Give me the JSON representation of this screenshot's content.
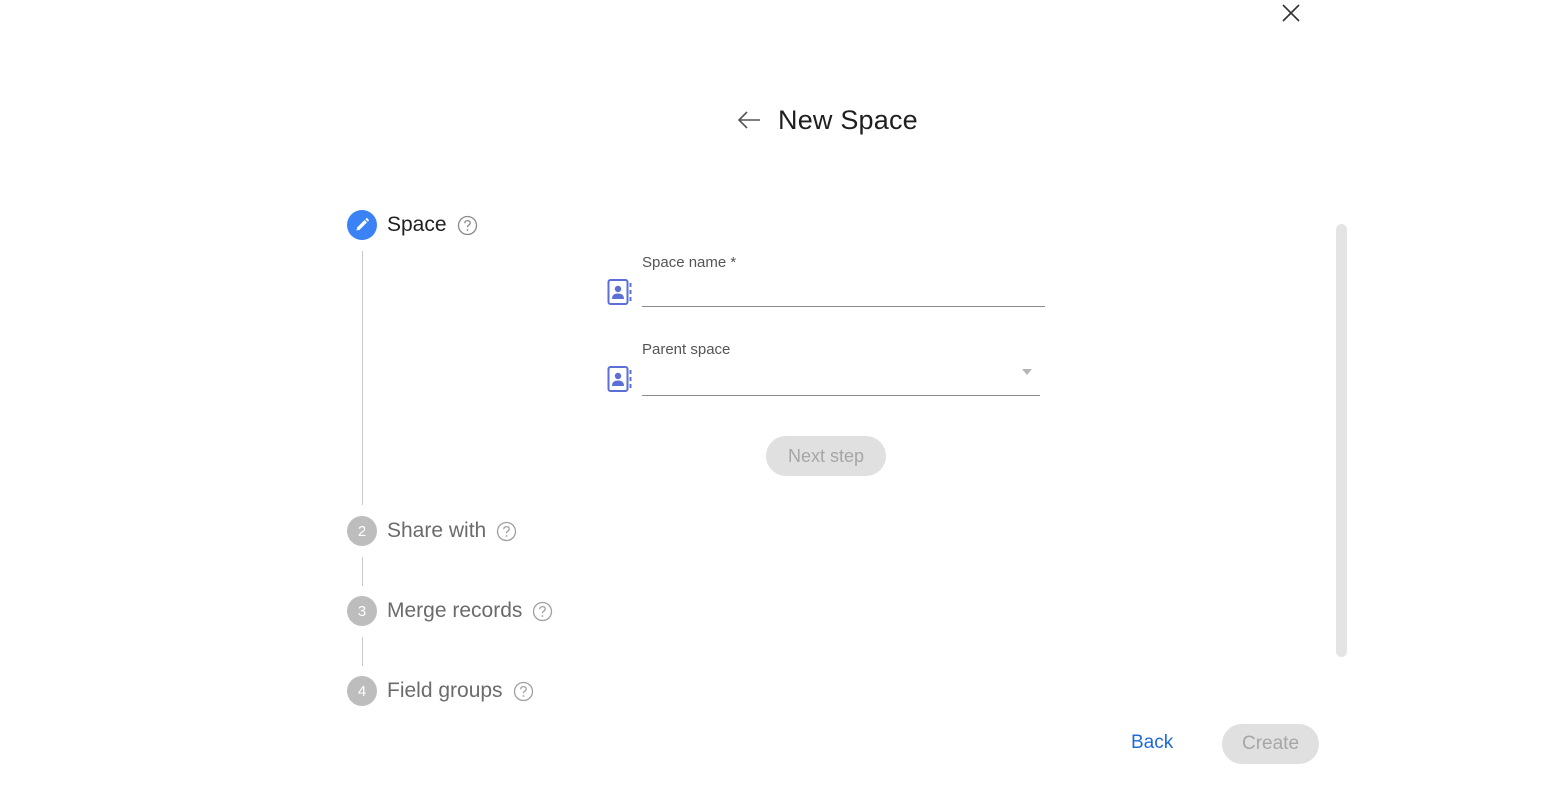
{
  "dialog": {
    "title": "New Space",
    "close_icon": "close-icon",
    "back_icon": "arrow-left-icon"
  },
  "stepper": {
    "steps": [
      {
        "number": "",
        "label": "Space",
        "state": "active",
        "icon": "pencil-icon"
      },
      {
        "number": "2",
        "label": "Share with",
        "state": "inactive"
      },
      {
        "number": "3",
        "label": "Merge records",
        "state": "inactive"
      },
      {
        "number": "4",
        "label": "Field groups",
        "state": "inactive"
      }
    ],
    "help_icon": "question-circle-icon"
  },
  "form": {
    "space_name": {
      "label": "Space name *",
      "value": "",
      "icon": "contact-book-icon"
    },
    "parent_space": {
      "label": "Parent space",
      "value": "",
      "icon": "contact-book-icon"
    },
    "next_step_label": "Next step"
  },
  "footer": {
    "back_label": "Back",
    "create_label": "Create"
  },
  "colors": {
    "accent": "#3b82f6",
    "link": "#1e6bd6",
    "icon_blue": "#5b6fd6",
    "disabled_bg": "#e0e0e0",
    "disabled_text": "#a6a6a6"
  }
}
